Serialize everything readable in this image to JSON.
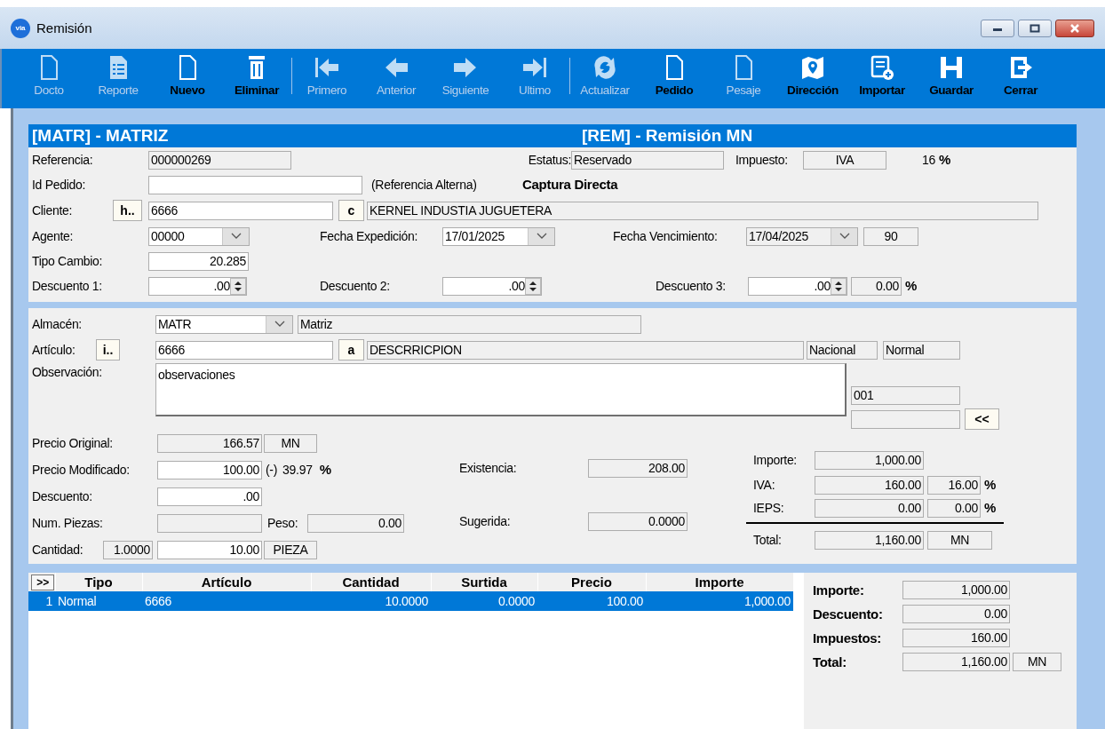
{
  "window": {
    "logo": "via",
    "title": "Remisión"
  },
  "toolbar": [
    {
      "label": "Docto",
      "disabled": true
    },
    {
      "label": "Reporte",
      "disabled": true
    },
    {
      "label": "Nuevo",
      "disabled": false
    },
    {
      "label": "Eliminar",
      "disabled": false
    },
    {
      "label": "Primero",
      "disabled": true
    },
    {
      "label": "Anterior",
      "disabled": true
    },
    {
      "label": "Siguiente",
      "disabled": true
    },
    {
      "label": "Ultimo",
      "disabled": true
    },
    {
      "label": "Actualizar",
      "disabled": true
    },
    {
      "label": "Pedido",
      "disabled": false
    },
    {
      "label": "Pesaje",
      "disabled": true
    },
    {
      "label": "Dirección",
      "disabled": false
    },
    {
      "label": "Importar",
      "disabled": false
    },
    {
      "label": "Guardar",
      "disabled": false
    },
    {
      "label": "Cerrar",
      "disabled": false
    }
  ],
  "header": {
    "branch": "[MATR] -  MATRIZ",
    "document": "[REM] - Remisión MN"
  },
  "referencia": {
    "label": "Referencia:",
    "value": "000000269"
  },
  "estatus": {
    "label": "Estatus:",
    "value": "Reservado"
  },
  "impuesto": {
    "label": "Impuesto:",
    "value": "IVA",
    "rate": "16",
    "unit": "%"
  },
  "id_pedido": {
    "label": "Id Pedido:",
    "note": "(Referencia Alterna)",
    "mode": "Captura Directa"
  },
  "cliente": {
    "label": "Cliente:",
    "lookup_button": "h..",
    "value": "6666",
    "name_button": "c",
    "name": "KERNEL INDUSTIA JUGUETERA"
  },
  "agente": {
    "label": "Agente:",
    "value": "00000"
  },
  "fecha_expedicion": {
    "label": "Fecha Expedición:",
    "value": "17/01/2025"
  },
  "fecha_vencimiento": {
    "label": "Fecha Vencimiento:",
    "value": "17/04/2025",
    "days": "90"
  },
  "tipo_cambio": {
    "label": "Tipo Cambio:",
    "value": "20.285"
  },
  "descuento_1": {
    "label": "Descuento 1:",
    "value": ".00"
  },
  "descuento_2": {
    "label": "Descuento 2:",
    "value": ".00"
  },
  "descuento_3": {
    "label": "Descuento 3:",
    "value": ".00",
    "total": "0.00",
    "unit": "%"
  },
  "almacen": {
    "label": "Almacén:",
    "value": "MATR",
    "name": "Matriz"
  },
  "articulo": {
    "label": "Artículo:",
    "lookup_button": "i..",
    "value": "6666",
    "name_button": "a",
    "name": "DESCRRICPION",
    "origin": "Nacional",
    "type": "Normal"
  },
  "observacion": {
    "label": "Observación:",
    "value": "observaciones"
  },
  "lote": {
    "value": "001",
    "back_button": "<<"
  },
  "precio_original": {
    "label": "Precio Original:",
    "value": "166.57",
    "currency": "MN"
  },
  "precio_modificado": {
    "label": "Precio Modificado:",
    "value": "100.00",
    "sign": "(-)",
    "percent": "39.97",
    "unit": "%"
  },
  "descuento": {
    "label": "Descuento:",
    "value": ".00"
  },
  "num_piezas": {
    "label": "Num. Piezas:"
  },
  "peso": {
    "label": "Peso:",
    "value": "0.00"
  },
  "cantidad": {
    "label": "Cantidad:",
    "factor": "1.0000",
    "value": "10.00",
    "unit": "PIEZA"
  },
  "existencia": {
    "label": "Existencia:",
    "value": "208.00"
  },
  "sugerida": {
    "label": "Sugerida:",
    "value": "0.0000"
  },
  "line_totals": {
    "importe": {
      "label": "Importe:",
      "value": "1,000.00"
    },
    "iva": {
      "label": "IVA:",
      "value": "160.00",
      "rate": "16.00",
      "unit": "%"
    },
    "ieps": {
      "label": "IEPS:",
      "value": "0.00",
      "rate": "0.00",
      "unit": "%"
    },
    "total": {
      "label": "Total:",
      "value": "1,160.00",
      "currency": "MN"
    }
  },
  "table": {
    "columns": [
      ">>",
      "Tipo",
      "Artículo",
      "Cantidad",
      "Surtida",
      "Precio",
      "Importe"
    ],
    "rows": [
      {
        "selected": true,
        "cells": [
          "1",
          "Normal",
          "6666",
          "10.0000",
          "0.0000",
          "100.00",
          "1,000.00"
        ]
      }
    ]
  },
  "summary": {
    "importe": {
      "label": "Importe:",
      "value": "1,000.00"
    },
    "descuento": {
      "label": "Descuento:",
      "value": "0.00"
    },
    "impuestos": {
      "label": "Impuestos:",
      "value": "160.00"
    },
    "total": {
      "label": "Total:",
      "value": "1,160.00",
      "currency": "MN"
    }
  }
}
